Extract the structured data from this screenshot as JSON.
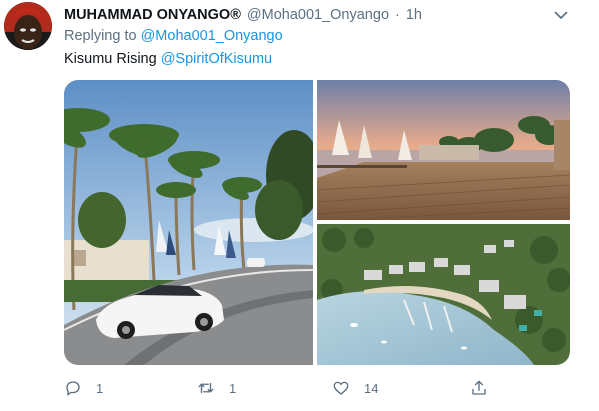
{
  "tweet": {
    "display_name": "MUHAMMAD ONYANGO®",
    "handle": "@Moha001_Onyango",
    "separator": "·",
    "time": "1h",
    "replying_prefix": "Replying to",
    "replying_handle": "@Moha001_Onyango",
    "text": "Kisumu Rising",
    "mention": "@SpiritOfKisumu"
  },
  "media": {
    "images": [
      {
        "subject": "street-with-palm-trees-and-white-car"
      },
      {
        "subject": "wooden-boardwalk-with-sailboats-at-sunset"
      },
      {
        "subject": "aerial-view-of-waterfront-marina"
      }
    ]
  },
  "actions": {
    "reply_count": "1",
    "retweet_count": "1",
    "like_count": "14",
    "icons": [
      "reply-icon",
      "retweet-icon",
      "like-icon",
      "share-icon"
    ]
  },
  "colors": {
    "text_primary": "#0f1419",
    "text_secondary": "#5b7083",
    "link": "#1b95e0"
  }
}
